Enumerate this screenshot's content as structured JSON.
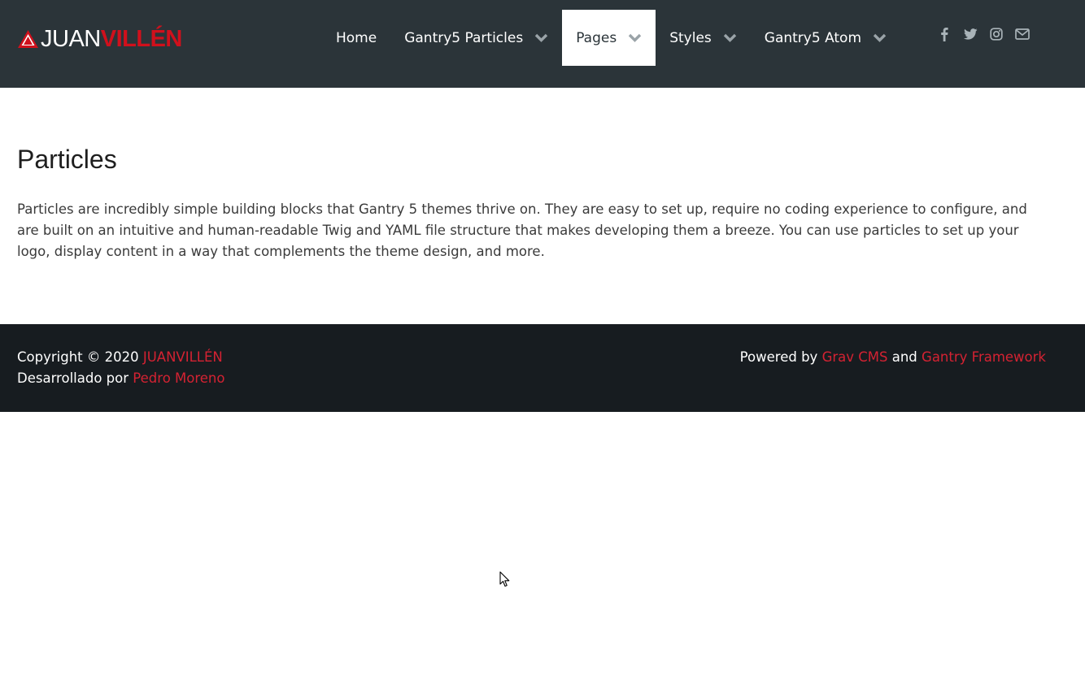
{
  "header": {
    "logo": {
      "text_light": "JUAN",
      "text_bold": "VILLÉN",
      "icon": "mountain-logo-icon"
    },
    "nav": [
      {
        "label": "Home",
        "has_dropdown": false,
        "active": false
      },
      {
        "label": "Gantry5 Particles",
        "has_dropdown": true,
        "active": false
      },
      {
        "label": "Pages",
        "has_dropdown": true,
        "active": true
      },
      {
        "label": "Styles",
        "has_dropdown": true,
        "active": false
      },
      {
        "label": "Gantry5 Atom",
        "has_dropdown": true,
        "active": false
      }
    ],
    "social": [
      "facebook-icon",
      "twitter-icon",
      "instagram-icon",
      "envelope-icon"
    ]
  },
  "main": {
    "title": "Particles",
    "body": "Particles are incredibly simple building blocks that Gantry 5 themes thrive on. They are easy to set up, require no coding experience to configure, and are built on an intuitive and human-readable Twig and YAML file structure that makes developing them a breeze. You can use particles to set up your logo, display content in a way that complements the theme design, and more."
  },
  "footer": {
    "copyright_prefix": "Copyright © 2020",
    "copyright_link": "JUANVILLÉN",
    "developed_prefix": "Desarrollado por",
    "developed_link": "Pedro Moreno",
    "powered_prefix": "Powered by",
    "powered_link_1": "Grav CMS",
    "powered_and": "and",
    "powered_link_2": "Gantry Framework"
  },
  "colors": {
    "header_bg": "#2b3439",
    "footer_bg": "#171c20",
    "accent": "#d0101c"
  }
}
